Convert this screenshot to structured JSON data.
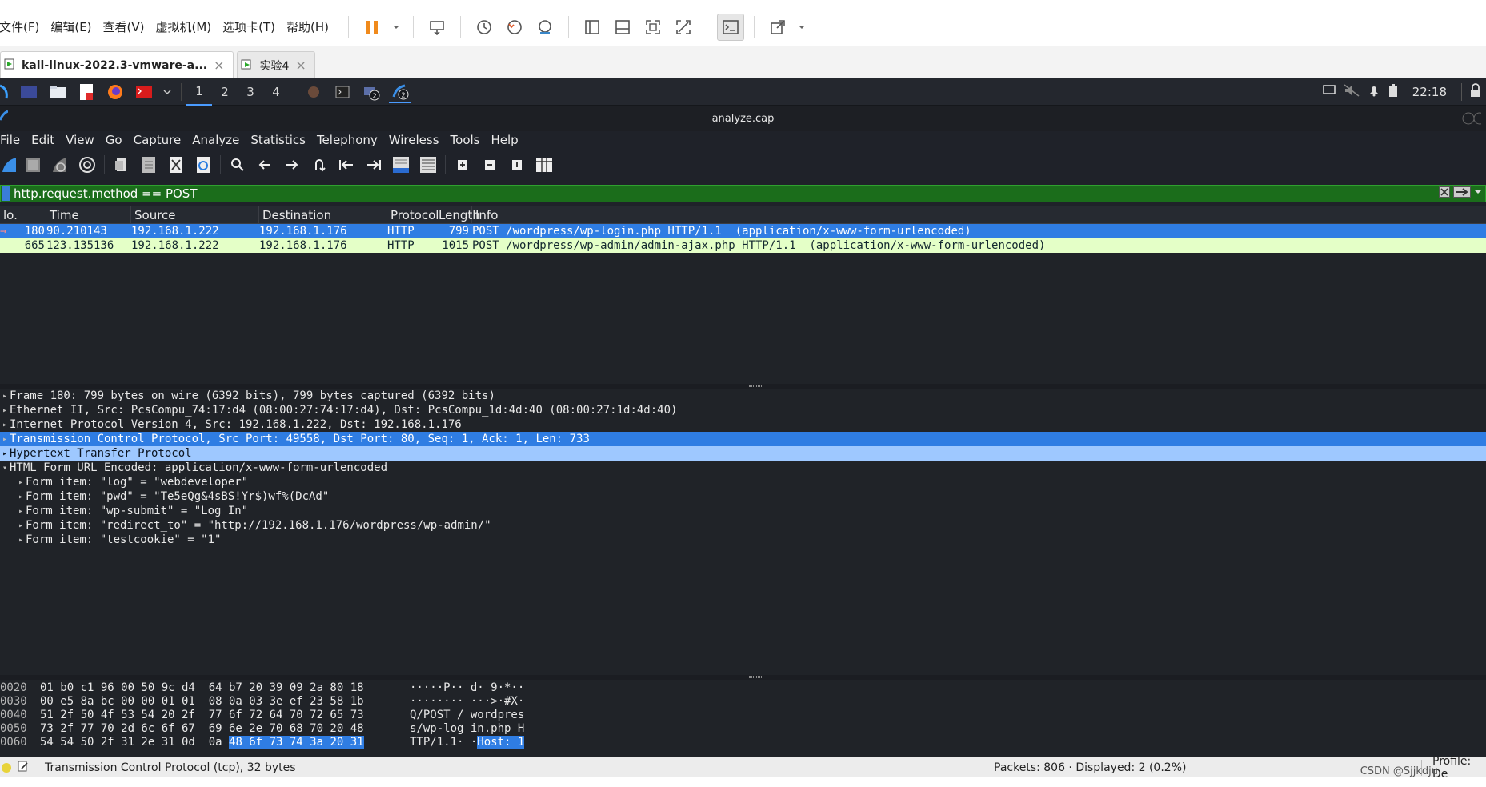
{
  "vm": {
    "menus": [
      "文件(F)",
      "编辑(E)",
      "查看(V)",
      "虚拟机(M)",
      "选项卡(T)",
      "帮助(H)"
    ],
    "tabs": [
      {
        "label": "kali-linux-2022.3-vmware-a...",
        "active": true
      },
      {
        "label": "实验4",
        "active": false
      }
    ]
  },
  "panel": {
    "workspaces": [
      "1",
      "2",
      "3",
      "4"
    ],
    "clock": "22:18",
    "badge": "2"
  },
  "window": {
    "title": "analyze.cap"
  },
  "ws_menus": [
    "File",
    "Edit",
    "View",
    "Go",
    "Capture",
    "Analyze",
    "Statistics",
    "Telephony",
    "Wireless",
    "Tools",
    "Help"
  ],
  "filter": {
    "value": "http.request.method == POST"
  },
  "packet_list": {
    "headers": [
      "lo.",
      "Time",
      "Source",
      "Destination",
      "Protocol",
      "Length",
      "Info"
    ],
    "rows": [
      {
        "no": "180",
        "time": "90.210143",
        "src": "192.168.1.222",
        "dst": "192.168.1.176",
        "proto": "HTTP",
        "len": "799",
        "info": "POST /wordpress/wp-login.php HTTP/1.1  (application/x-www-form-urlencoded)"
      },
      {
        "no": "665",
        "time": "123.135136",
        "src": "192.168.1.222",
        "dst": "192.168.1.176",
        "proto": "HTTP",
        "len": "1015",
        "info": "POST /wordpress/wp-admin/admin-ajax.php HTTP/1.1  (application/x-www-form-urlencoded)"
      }
    ]
  },
  "details": [
    "Frame 180: 799 bytes on wire (6392 bits), 799 bytes captured (6392 bits)",
    "Ethernet II, Src: PcsCompu_74:17:d4 (08:00:27:74:17:d4), Dst: PcsCompu_1d:4d:40 (08:00:27:1d:4d:40)",
    "Internet Protocol Version 4, Src: 192.168.1.222, Dst: 192.168.1.176",
    "Transmission Control Protocol, Src Port: 49558, Dst Port: 80, Seq: 1, Ack: 1, Len: 733",
    "Hypertext Transfer Protocol",
    "HTML Form URL Encoded: application/x-www-form-urlencoded"
  ],
  "form_items": [
    "Form item: \"log\" = \"webdeveloper\"",
    "Form item: \"pwd\" = \"Te5eQg&4sBS!Yr$)wf%(DcAd\"",
    "Form item: \"wp-submit\" = \"Log In\"",
    "Form item: \"redirect_to\" = \"http://192.168.1.176/wordpress/wp-admin/\"",
    "Form item: \"testcookie\" = \"1\""
  ],
  "bytes": [
    {
      "off": "0020",
      "hex": "01 b0 c1 96 00 50 9c d4  64 b7 20 39 09 2a 80 18",
      "hex_hl": "",
      "asc": "·····P·· d· 9·*··",
      "asc_hl": ""
    },
    {
      "off": "0030",
      "hex": "00 e5 8a bc 00 00 01 01  08 0a 03 3e ef 23 58 1b",
      "hex_hl": "",
      "asc": "········ ···>·#X·",
      "asc_hl": ""
    },
    {
      "off": "0040",
      "hex": "51 2f 50 4f 53 54 20 2f  77 6f 72 64 70 72 65 73",
      "hex_hl": "",
      "asc": "Q/POST / wordpres",
      "asc_hl": ""
    },
    {
      "off": "0050",
      "hex": "73 2f 77 70 2d 6c 6f 67  69 6e 2e 70 68 70 20 48",
      "hex_hl": "",
      "asc": "s/wp-log in.php H",
      "asc_hl": ""
    },
    {
      "off": "0060",
      "hex": "54 54 50 2f 31 2e 31 0d  0a ",
      "hex_hl": "48 6f 73 74 3a 20 31",
      "asc": "TTP/1.1· ·",
      "asc_hl": "Host: 1"
    }
  ],
  "status": {
    "left": "Transmission Control Protocol (tcp), 32 bytes",
    "packets": "Packets: 806 · Displayed: 2 (0.2%)",
    "profile": "Profile: De"
  },
  "watermark": "CSDN @Sjjkdju",
  "colors": {
    "selection": "#2f7de3",
    "filter_ok": "#1b6d1b",
    "alt_row": "#e4ffc7"
  }
}
